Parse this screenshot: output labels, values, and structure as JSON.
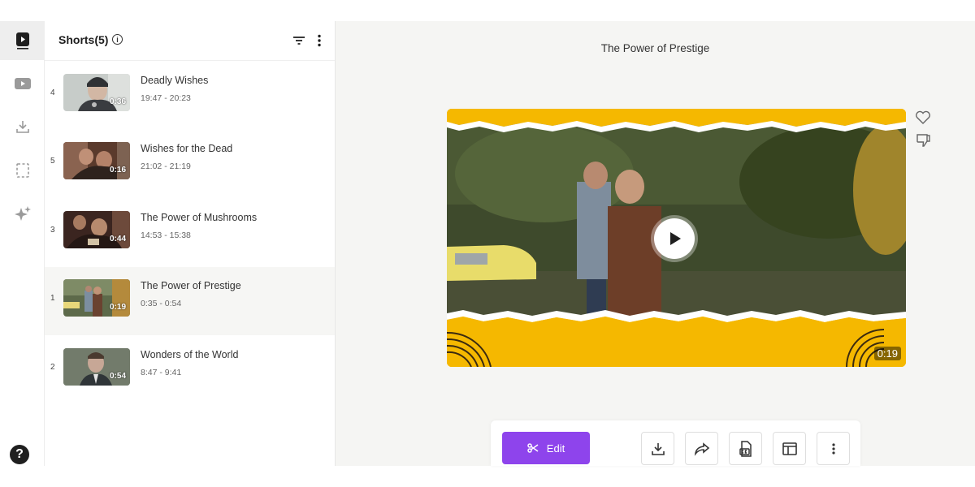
{
  "rail": {
    "items": [
      {
        "icon": "shorts-icon",
        "active": true
      },
      {
        "icon": "youtube-icon",
        "active": false
      },
      {
        "icon": "download-icon",
        "active": false
      },
      {
        "icon": "crop-icon",
        "active": false
      },
      {
        "icon": "sparkle-icon",
        "active": false
      }
    ],
    "help_label": "?"
  },
  "list": {
    "title": "Shorts(5)",
    "info_symbol": "i",
    "clips": [
      {
        "rank": "4",
        "title": "Deadly Wishes",
        "range": "19:47 - 20:23",
        "duration": "0:36",
        "active": false
      },
      {
        "rank": "5",
        "title": "Wishes for the Dead",
        "range": "21:02 - 21:19",
        "duration": "0:16",
        "active": false
      },
      {
        "rank": "3",
        "title": "The Power of Mushrooms",
        "range": "14:53 - 15:38",
        "duration": "0:44",
        "active": false
      },
      {
        "rank": "1",
        "title": "The Power of Prestige",
        "range": "0:35 - 0:54",
        "duration": "0:19",
        "active": true
      },
      {
        "rank": "2",
        "title": "Wonders of the World",
        "range": "8:47 - 9:41",
        "duration": "0:54",
        "active": false
      }
    ]
  },
  "main": {
    "title": "The Power of Prestige",
    "player_duration": "0:19",
    "edit_label": "Edit"
  },
  "colors": {
    "accent": "#8e44ec",
    "banner_yellow": "#f3b400"
  }
}
